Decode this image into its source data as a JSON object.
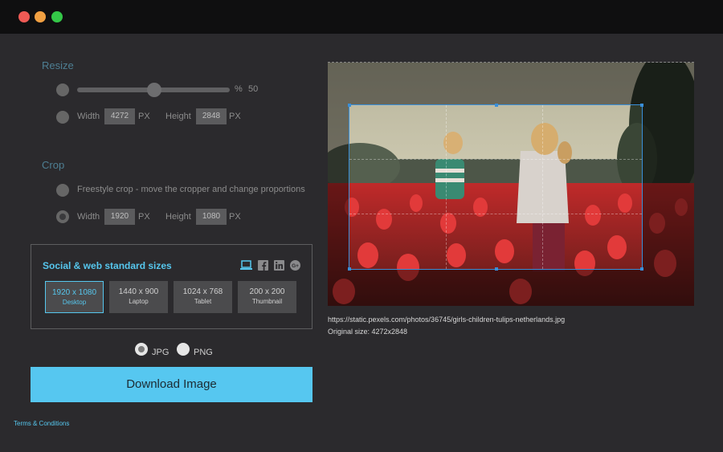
{
  "window": {
    "controls": [
      "close",
      "minimize",
      "maximize"
    ]
  },
  "resize": {
    "title": "Resize",
    "percent_symbol": "%",
    "percent_value": "50",
    "width_label": "Width",
    "width_value": "4272",
    "width_unit": "PX",
    "height_label": "Height",
    "height_value": "2848",
    "height_unit": "PX",
    "slider_level": 0.5
  },
  "crop": {
    "title": "Crop",
    "freestyle_label": "Freestyle crop - move the cropper and change proportions",
    "width_label": "Width",
    "width_value": "1920",
    "width_unit": "PX",
    "height_label": "Height",
    "height_value": "1080",
    "height_unit": "PX"
  },
  "social": {
    "title": "Social & web standard sizes",
    "icons": [
      "laptop-icon",
      "facebook-icon",
      "linkedin-icon",
      "googleplus-icon"
    ],
    "sizes": [
      {
        "dim": "1920 x 1080",
        "name": "Desktop"
      },
      {
        "dim": "1440 x 900",
        "name": "Laptop"
      },
      {
        "dim": "1024 x 768",
        "name": "Tablet"
      },
      {
        "dim": "200 x 200",
        "name": "Thumbnail"
      }
    ]
  },
  "format": {
    "jpg": "JPG",
    "png": "PNG",
    "selected": "JPG"
  },
  "download_label": "Download Image",
  "terms_label": "Terms & Conditions",
  "image": {
    "url": "https://static.pexels.com/photos/36745/girls-children-tulips-netherlands.jpg",
    "original_size": "Original size: 4272x2848"
  },
  "colors": {
    "accent": "#56c7ee",
    "background": "#2b2a2d",
    "crop_border": "#3a8fd8"
  }
}
